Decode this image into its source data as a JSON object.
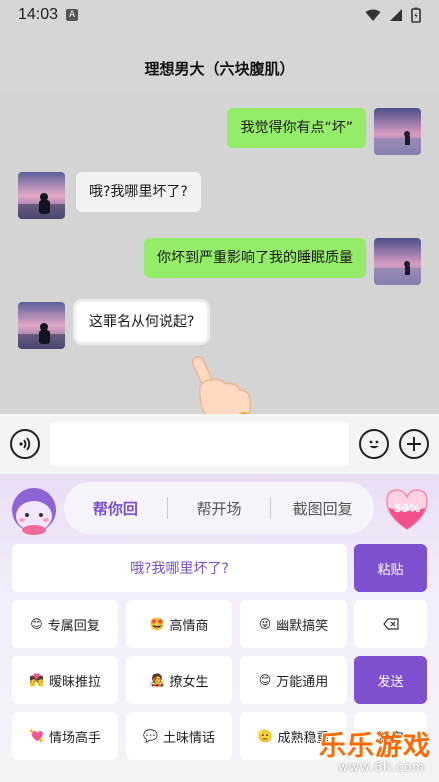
{
  "status": {
    "time": "14:03",
    "badge": "A"
  },
  "chat_title": "理想男大（六块腹肌）",
  "messages": [
    {
      "side": "right",
      "text": "我觉得你有点“坏”"
    },
    {
      "side": "left",
      "text": "哦?我哪里坏了?"
    },
    {
      "side": "right",
      "text": "你坏到严重影响了我的睡眠质量"
    },
    {
      "side": "left",
      "text": "这罪名从何说起?"
    }
  ],
  "input": {
    "voice_icon": "voice-icon",
    "emoji_icon": "emoji-icon",
    "plus_icon": "plus-icon"
  },
  "keyboard": {
    "tabs": [
      "帮你回",
      "帮开场",
      "截图回复"
    ],
    "badge_percent": "59%",
    "suggestion": "哦?我哪里坏了?",
    "paste": "粘贴",
    "send": "发送",
    "clear": "清空",
    "keys": [
      {
        "emoji": "😊",
        "label": "专属回复"
      },
      {
        "emoji": "🤩",
        "label": "高情商"
      },
      {
        "emoji": "😜",
        "label": "幽默搞笑"
      },
      {
        "emoji": "💏",
        "label": "暧昧推拉"
      },
      {
        "emoji": "🧑‍🎤",
        "label": "撩女生"
      },
      {
        "emoji": "😊",
        "label": "万能通用"
      },
      {
        "emoji": "💘",
        "label": "情场高手"
      },
      {
        "emoji": "💬",
        "label": "土味情话"
      },
      {
        "emoji": "🫡",
        "label": "成熟稳重"
      }
    ]
  },
  "watermark": {
    "title": "乐乐游戏",
    "url": "www.6ll.com"
  },
  "colors": {
    "accent": "#7e4fcf",
    "bubble_green": "#95ec69"
  }
}
